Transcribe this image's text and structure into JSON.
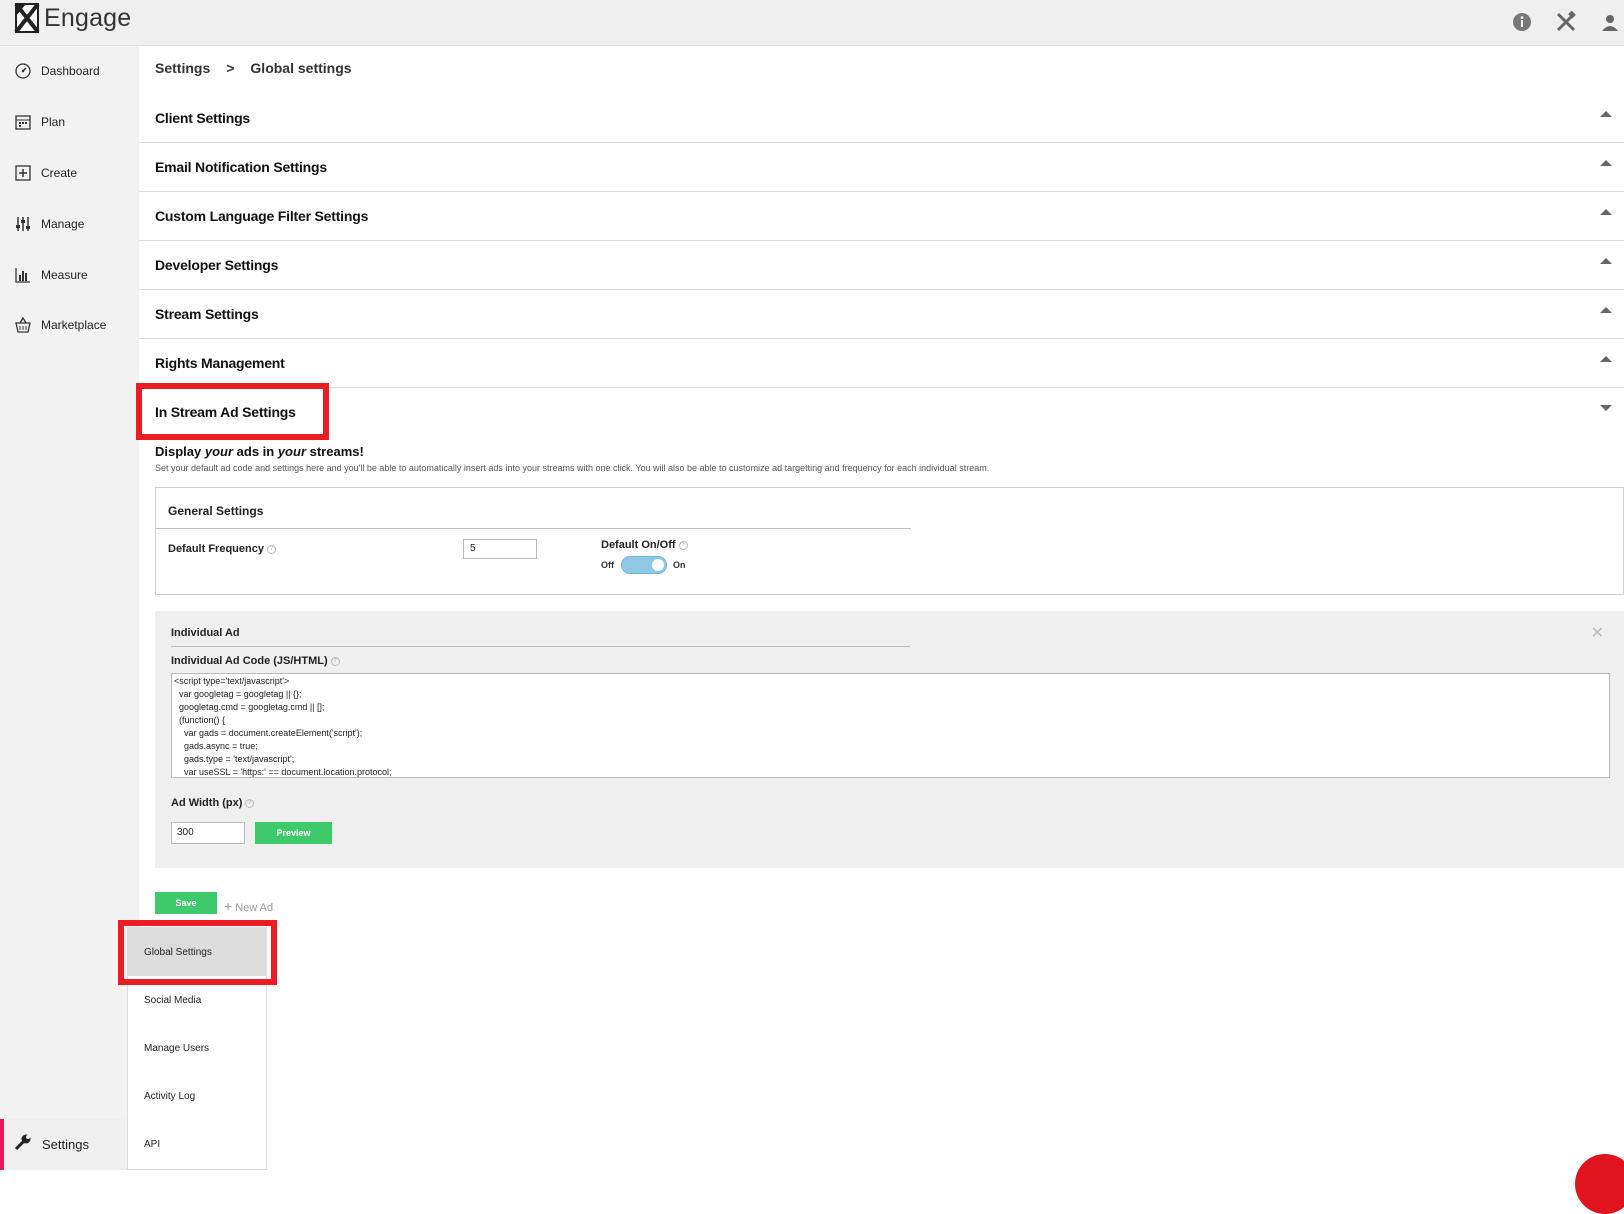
{
  "app": {
    "title": "Engage"
  },
  "top_icons": [
    "info-icon",
    "tools-icon",
    "user-icon"
  ],
  "sidebar": {
    "items": [
      {
        "label": "Dashboard",
        "icon": "dashboard-icon"
      },
      {
        "label": "Plan",
        "icon": "calendar-icon"
      },
      {
        "label": "Create",
        "icon": "plus-square-icon"
      },
      {
        "label": "Manage",
        "icon": "sliders-icon"
      },
      {
        "label": "Measure",
        "icon": "bar-chart-icon"
      },
      {
        "label": "Marketplace",
        "icon": "basket-icon"
      }
    ],
    "settings_label": "Settings"
  },
  "breadcrumb": {
    "root": "Settings",
    "separator": ">",
    "current": "Global settings"
  },
  "sections": [
    {
      "title": "Client Settings",
      "state": "collapsed"
    },
    {
      "title": "Email Notification Settings",
      "state": "collapsed"
    },
    {
      "title": "Custom Language Filter Settings",
      "state": "collapsed"
    },
    {
      "title": "Developer Settings",
      "state": "collapsed"
    },
    {
      "title": "Stream Settings",
      "state": "collapsed"
    },
    {
      "title": "Rights Management",
      "state": "collapsed"
    },
    {
      "title": "In Stream Ad Settings",
      "state": "expanded"
    }
  ],
  "ad_settings": {
    "heading_pre": "Display ",
    "heading_em1": "your",
    "heading_mid": " ads in ",
    "heading_em2": "your",
    "heading_post": " streams!",
    "subtitle": "Set your default ad code and settings here and you'll be able to automatically insert ads into your streams with one click. You will also be able to customize ad targetting and frequency for each individual stream.",
    "general": {
      "title": "General Settings",
      "frequency_label": "Default Frequency",
      "frequency_value": "5",
      "onoff_label": "Default On/Off",
      "off_label": "Off",
      "on_label": "On",
      "toggle_on": true
    },
    "individual": {
      "title": "Individual Ad",
      "code_label": "Individual Ad Code (JS/HTML)",
      "code_value": "<script type='text/javascript'>\n  var googletag = googletag || {};\n  googletag.cmd = googletag.cmd || [];\n  (function() {\n    var gads = document.createElement('script');\n    gads.async = true;\n    gads.type = 'text/javascript';\n    var useSSL = 'https:' == document.location.protocol;",
      "width_label": "Ad Width (px)",
      "width_value": "300",
      "preview_label": "Preview"
    },
    "save_label": "Save",
    "new_ad_label": "New Ad"
  },
  "settings_menu": [
    "Global Settings",
    "Social Media",
    "Manage Users",
    "Activity Log",
    "API"
  ],
  "colors": {
    "accent_green": "#3ec96b",
    "highlight_red": "#ec1c24",
    "settings_marker": "#e6175c"
  }
}
